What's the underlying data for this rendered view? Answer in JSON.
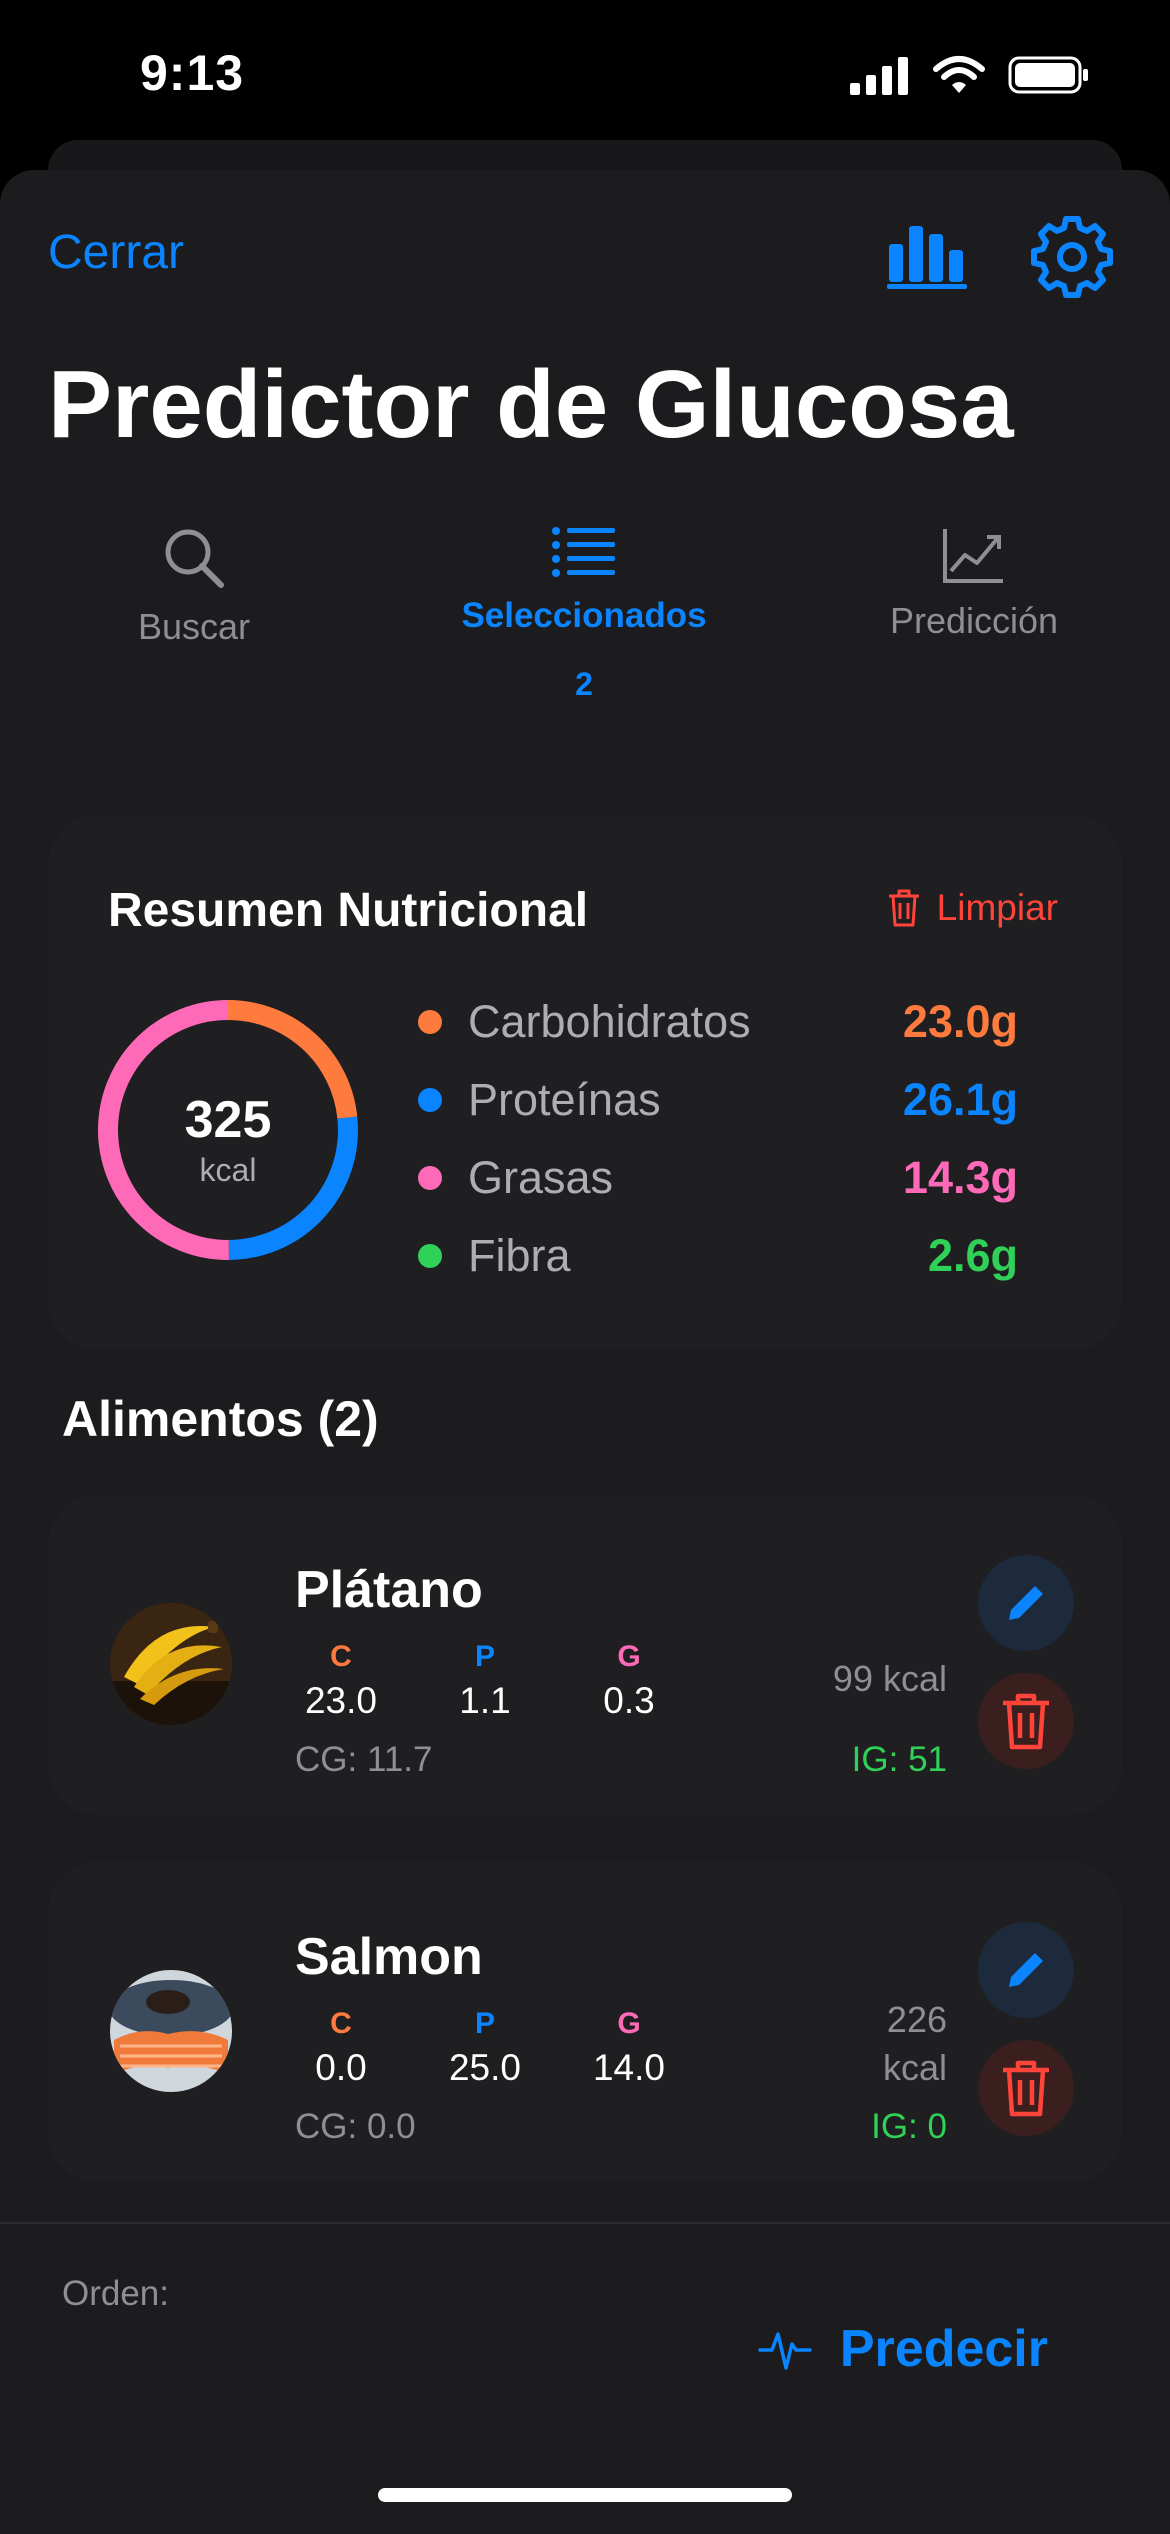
{
  "status": {
    "time": "9:13"
  },
  "header": {
    "close_label": "Cerrar",
    "title": "Predictor de Glucosa"
  },
  "tabs": [
    {
      "label": "Buscar"
    },
    {
      "label": "Seleccionados",
      "count": "2"
    },
    {
      "label": "Predicción"
    }
  ],
  "summary": {
    "title": "Resumen Nutricional",
    "clear_label": "Limpiar",
    "calories": "325",
    "calories_unit": "kcal",
    "macros": [
      {
        "name": "Carbohidratos",
        "value": "23.0g",
        "color": "#ff7a3d"
      },
      {
        "name": "Proteínas",
        "value": "26.1g",
        "color": "#0a84ff"
      },
      {
        "name": "Grasas",
        "value": "14.3g",
        "color": "#ff6ab8"
      },
      {
        "name": "Fibra",
        "value": "2.6g",
        "color": "#30d158"
      }
    ]
  },
  "foods_section": {
    "title": "Alimentos (2)"
  },
  "foods": [
    {
      "name": "Plátano",
      "c_label": "C",
      "p_label": "P",
      "g_label": "G",
      "c": "23.0",
      "p": "1.1",
      "g": "0.3",
      "cg": "CG: 11.7",
      "kcal_line1": "99 kcal",
      "kcal_line2": "",
      "ig": "IG: 51"
    },
    {
      "name": "Salmon",
      "c_label": "C",
      "p_label": "P",
      "g_label": "G",
      "c": "0.0",
      "p": "25.0",
      "g": "14.0",
      "cg": "CG: 0.0",
      "kcal_line1": "226",
      "kcal_line2": "kcal",
      "ig": "IG: 0"
    }
  ],
  "footer": {
    "order_label": "Orden:",
    "predict_label": "Predecir"
  },
  "colors": {
    "accent": "#0a84ff",
    "danger": "#ff453a",
    "carb": "#ff7a3d",
    "protein": "#0a84ff",
    "fat": "#ff6ab8",
    "fiber": "#30d158"
  }
}
